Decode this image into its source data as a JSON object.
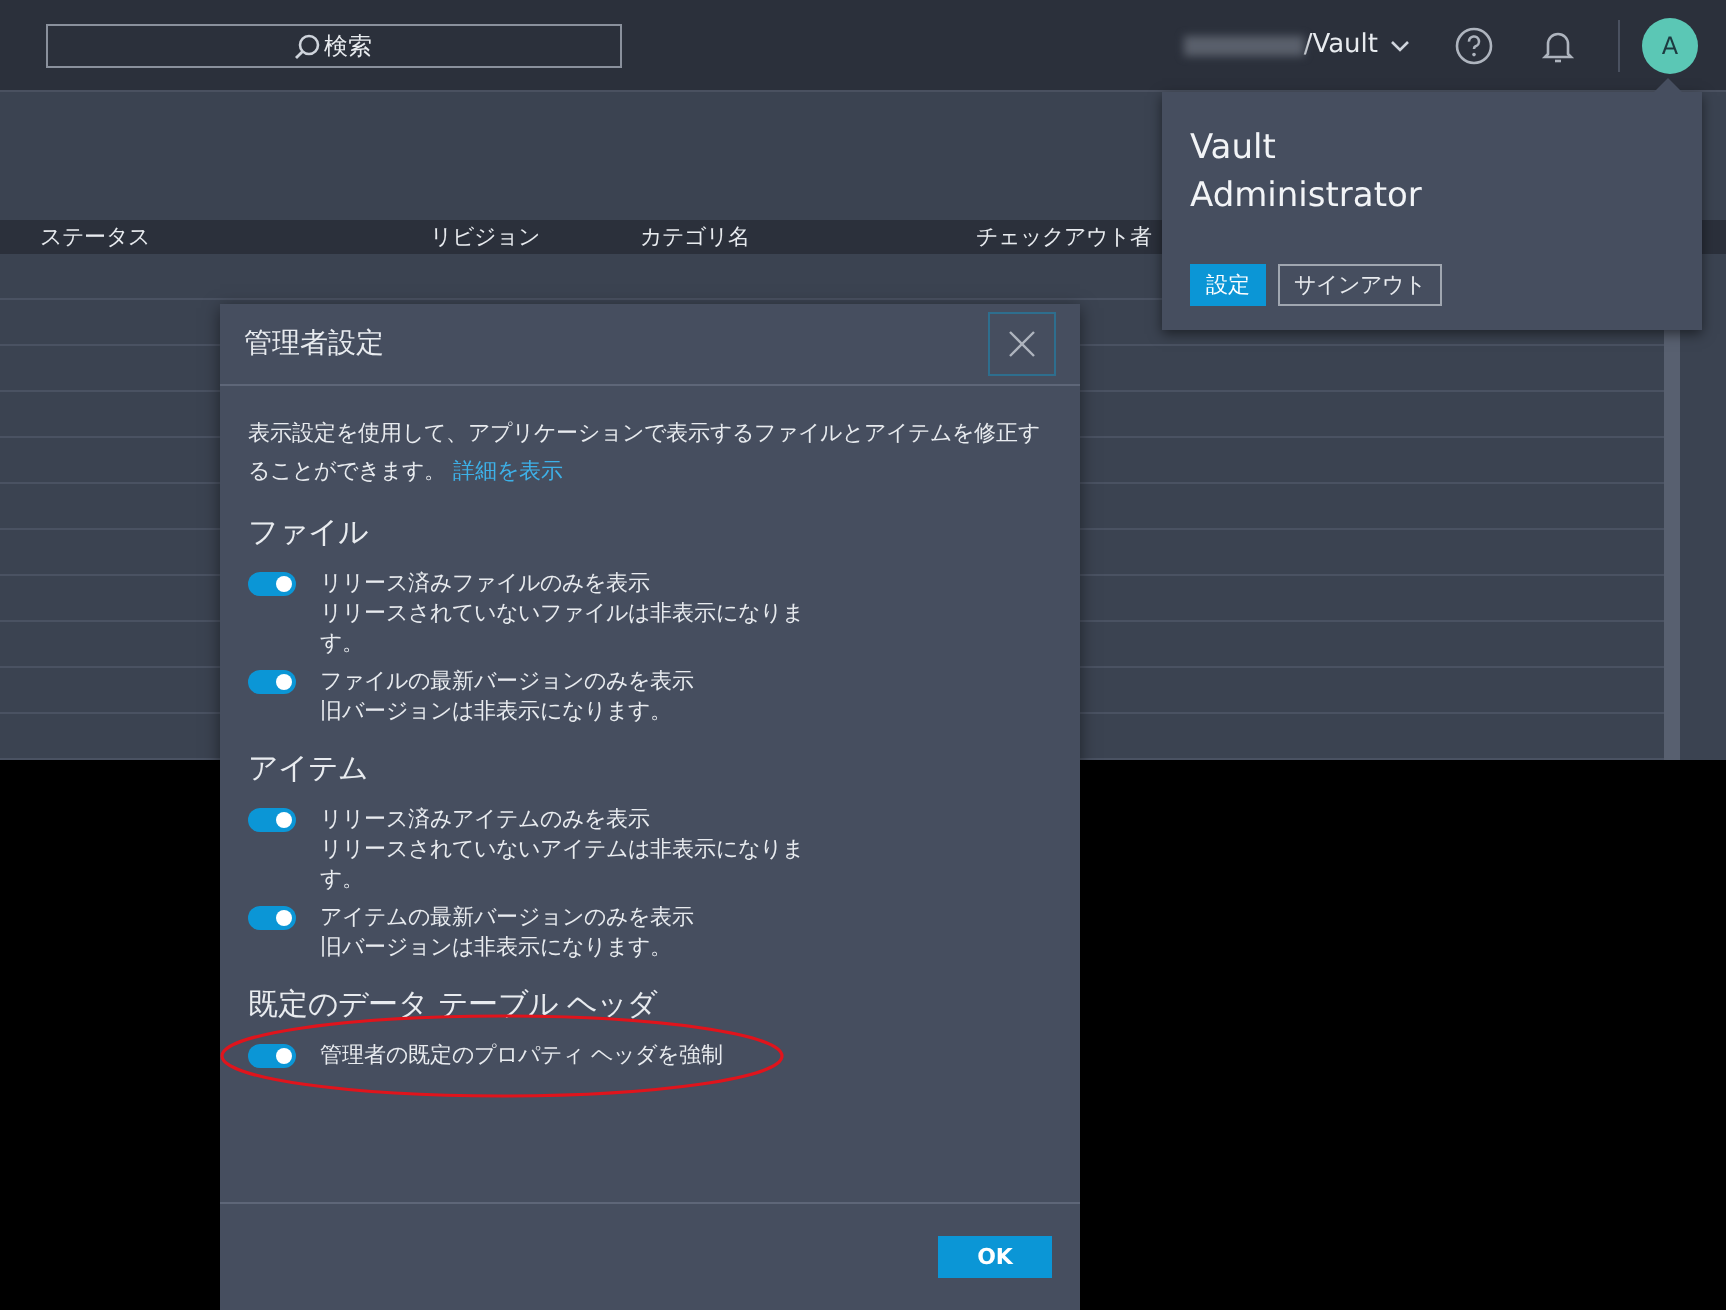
{
  "topbar": {
    "search": {
      "placeholder": "検索"
    },
    "tenant": "/Vault",
    "avatar": "A"
  },
  "table": {
    "columns": [
      "ステータス",
      "リビジョン",
      "カテゴリ名",
      "チェックアウト者"
    ]
  },
  "account_menu": {
    "name": "Vault Administrator",
    "buttons": [
      {
        "label": "設定",
        "primary": true
      },
      {
        "label": "サインアウト",
        "primary": false
      }
    ]
  },
  "dialog": {
    "title": "管理者設定",
    "intro": "表示設定を使用して、アプリケーションで表示するファイルとアイテムを修正することができます。",
    "link": "詳細を表示",
    "sections": [
      {
        "heading": "ファイル",
        "options": [
          {
            "label": "リリース済みファイルのみを表示",
            "description": "リリースされていないファイルは非表示になります。",
            "on": true,
            "highlighted": false
          },
          {
            "label": "ファイルの最新バージョンのみを表示",
            "description": "旧バージョンは非表示になります。",
            "on": true,
            "highlighted": false
          }
        ]
      },
      {
        "heading": "アイテム",
        "options": [
          {
            "label": "リリース済みアイテムのみを表示",
            "description": "リリースされていないアイテムは非表示になります。",
            "on": true,
            "highlighted": false
          },
          {
            "label": "アイテムの最新バージョンのみを表示",
            "description": "旧バージョンは非表示になります。",
            "on": true,
            "highlighted": false
          }
        ]
      },
      {
        "heading": "既定のデータ テーブル ヘッダ",
        "options": [
          {
            "label": "管理者の既定のプロパティ ヘッダを強制",
            "on": true,
            "highlighted": true
          }
        ]
      }
    ],
    "ok": "OK"
  }
}
